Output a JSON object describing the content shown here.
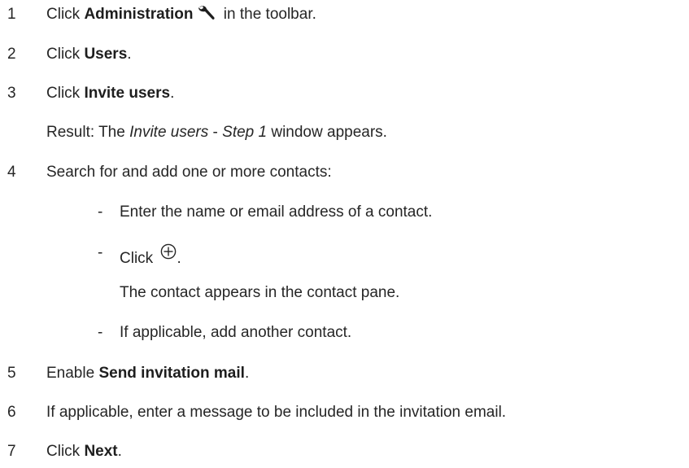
{
  "steps": [
    {
      "number": "1",
      "pre": "Click ",
      "bold": "Administration",
      "post": " in the toolbar.",
      "icon": "wrench-icon"
    },
    {
      "number": "2",
      "pre": "Click ",
      "bold": "Users",
      "post": "."
    },
    {
      "number": "3",
      "pre": "Click ",
      "bold": "Invite users",
      "post": "."
    },
    {
      "result": {
        "prefix": "Result: The ",
        "italic1": "Invite users",
        "sep": " - ",
        "italic2": "Step 1",
        "suffix": " window appears."
      }
    },
    {
      "number": "4",
      "text": "Search for and add one or more contacts:"
    },
    {
      "number": "5",
      "pre": "Enable ",
      "bold": "Send invitation mail",
      "post": "."
    },
    {
      "number": "6",
      "text": "If applicable, enter a message to be included in the invitation email."
    },
    {
      "number": "7",
      "pre": "Click ",
      "bold": "Next",
      "post": "."
    }
  ],
  "substeps": {
    "dash": "-",
    "a": "Enter the name or email address of a contact.",
    "b_pre": "Click ",
    "b_post": ".",
    "b_icon": "circle-plus-icon",
    "b_note": "The contact appears in the contact pane.",
    "c": "If applicable, add another contact."
  }
}
